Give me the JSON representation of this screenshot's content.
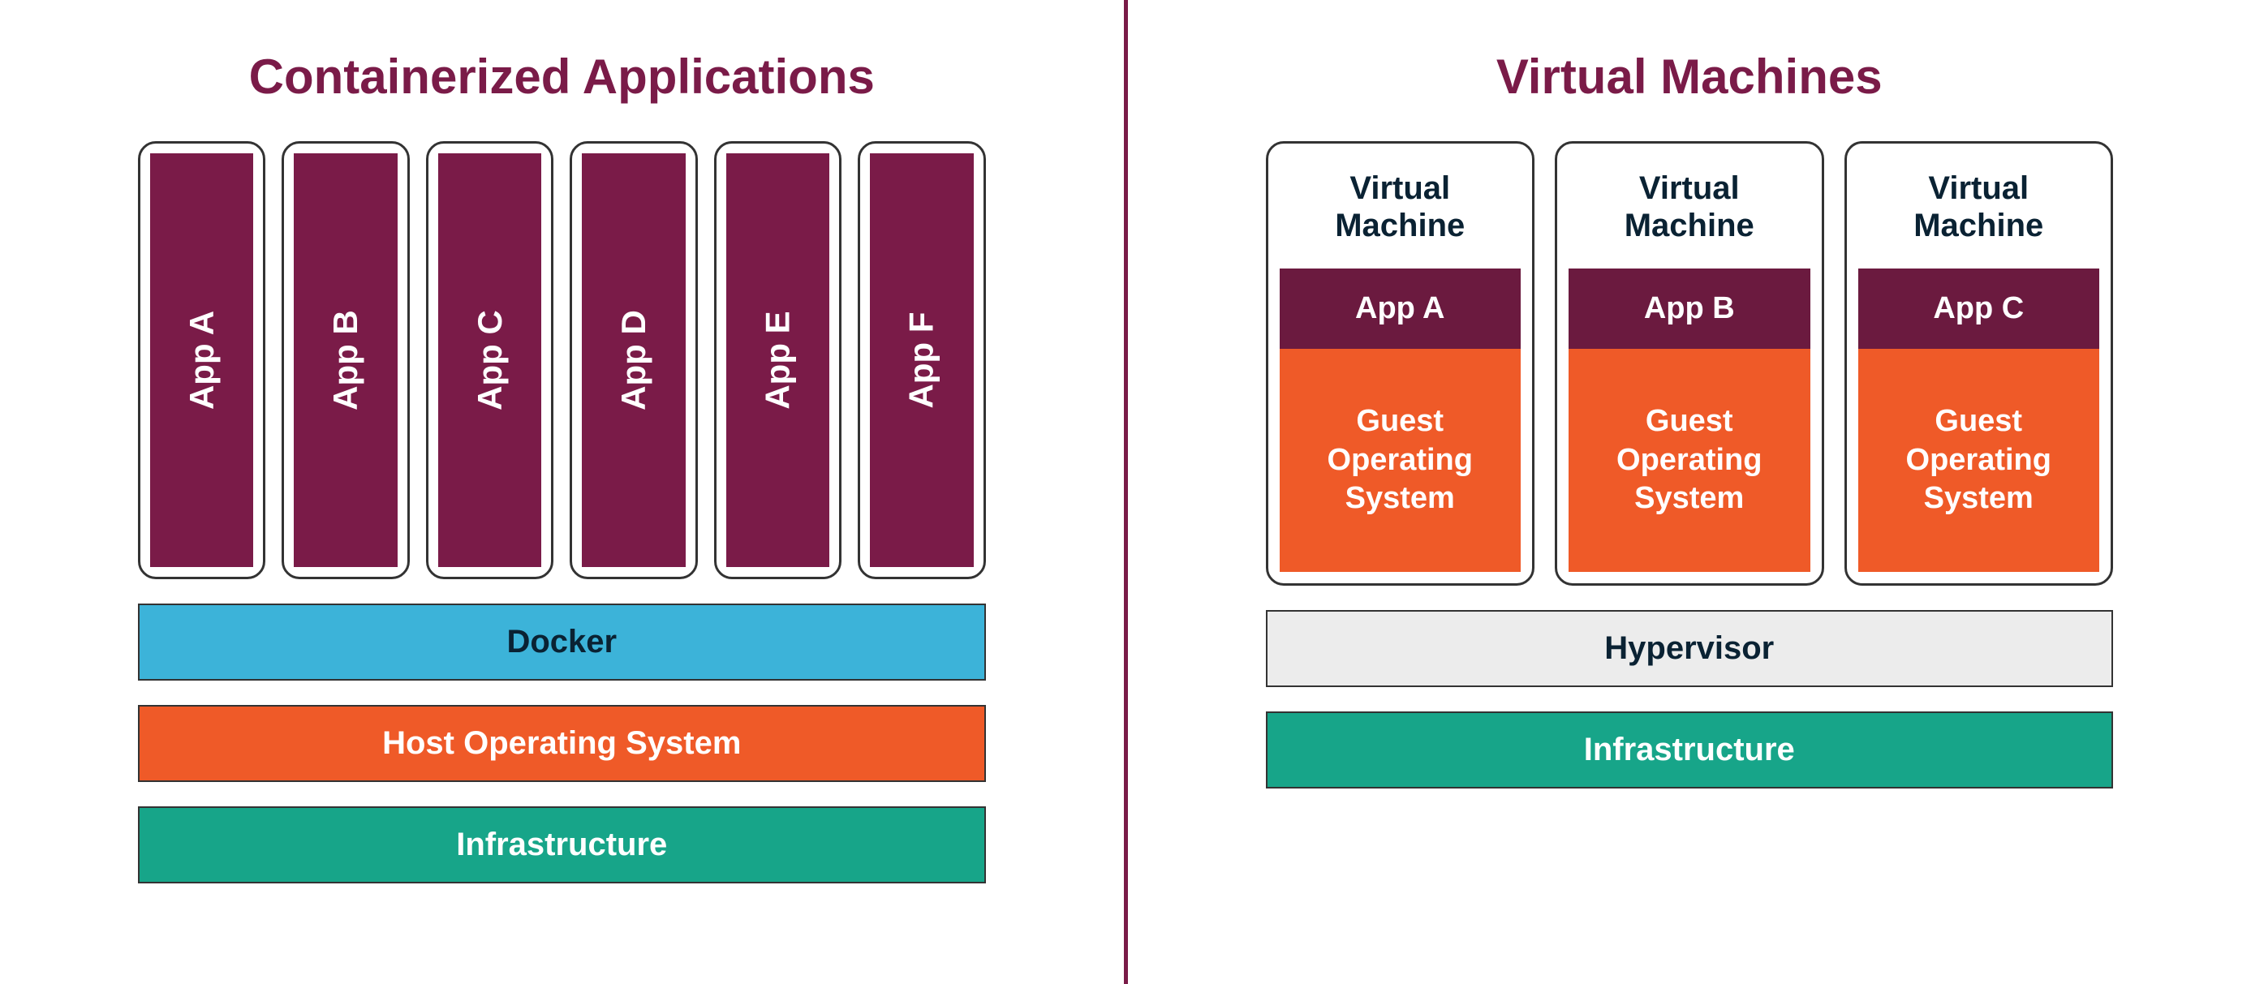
{
  "left": {
    "title": "Containerized Applications",
    "apps": [
      "App A",
      "App B",
      "App C",
      "App D",
      "App E",
      "App F"
    ],
    "layers": {
      "docker": "Docker",
      "host_os": "Host Operating System",
      "infrastructure": "Infrastructure"
    }
  },
  "right": {
    "title": "Virtual Machines",
    "vm_label": "Virtual\nMachine",
    "vms": [
      {
        "app": "App A",
        "guest": "Guest\nOperating\nSystem"
      },
      {
        "app": "App B",
        "guest": "Guest\nOperating\nSystem"
      },
      {
        "app": "App C",
        "guest": "Guest\nOperating\nSystem"
      }
    ],
    "layers": {
      "hypervisor": "Hypervisor",
      "infrastructure": "Infrastructure"
    }
  },
  "colors": {
    "maroon": "#7a1b48",
    "maroon_dark": "#6b1a3f",
    "orange": "#ef5a28",
    "teal": "#17a589",
    "blue": "#3cb3d9",
    "grey": "#ececec"
  }
}
